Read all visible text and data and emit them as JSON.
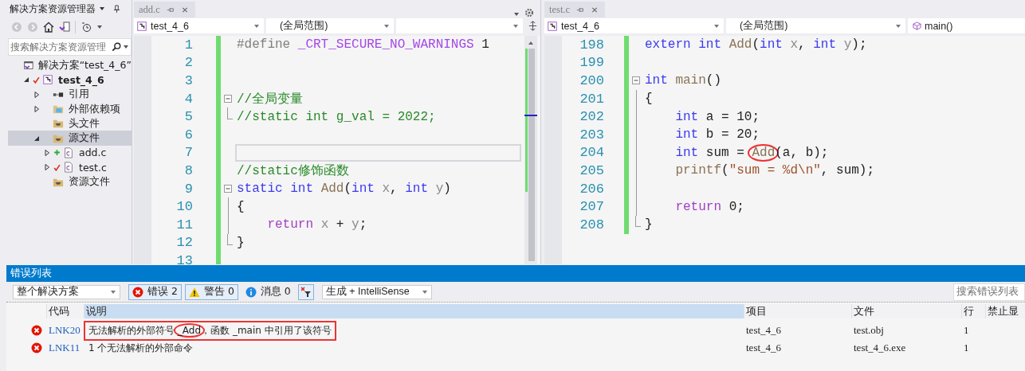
{
  "solution_explorer": {
    "title": "解决方案资源管理器",
    "search": {
      "placeholder": "搜索解决方案资源管理"
    },
    "tree": [
      {
        "label": "解决方案“test_4_6”",
        "kind": "solution",
        "selected": false,
        "modified": false,
        "added": false,
        "children": [
          {
            "label": "test_4_6",
            "kind": "project",
            "expanded": true,
            "selected": false,
            "modified": true,
            "added": false,
            "children": [
              {
                "label": "引用",
                "kind": "references",
                "expanded": false,
                "selected": false,
                "modified": false,
                "added": false
              },
              {
                "label": "外部依赖项",
                "kind": "external",
                "expanded": false,
                "selected": false,
                "modified": false,
                "added": false
              },
              {
                "label": "头文件",
                "kind": "folder",
                "selected": false,
                "modified": false,
                "added": false
              },
              {
                "label": "源文件",
                "kind": "folder",
                "expanded": true,
                "selected": true,
                "modified": false,
                "added": false,
                "children": [
                  {
                    "label": "add.c",
                    "kind": "file",
                    "expanded": false,
                    "selected": false,
                    "modified": false,
                    "added": true
                  },
                  {
                    "label": "test.c",
                    "kind": "file",
                    "expanded": false,
                    "selected": false,
                    "modified": true,
                    "added": false
                  }
                ]
              },
              {
                "label": "资源文件",
                "kind": "folder",
                "selected": false,
                "modified": false,
                "added": false
              }
            ]
          }
        ]
      }
    ]
  },
  "editors": [
    {
      "tab": "add.c",
      "overflow_tools": true,
      "nav": {
        "project": "test_4_6",
        "scope": "(全局范围)"
      },
      "lines": [
        {
          "n": "1",
          "kind": "plain",
          "current": false,
          "tokens": [
            {
              "kind": "pre",
              "text": "#define "
            },
            {
              "kind": "macro",
              "text": "_CRT_SECURE_NO_WARNINGS"
            },
            {
              "kind": "plain",
              "text": " 1"
            }
          ]
        },
        {
          "n": "2",
          "kind": "plain",
          "current": false
        },
        {
          "n": "3",
          "kind": "plain",
          "current": false
        },
        {
          "n": "4",
          "kind": "fold_start",
          "current": false,
          "tokens": [
            {
              "kind": "comment",
              "text": "//全局变量"
            }
          ]
        },
        {
          "n": "5",
          "kind": "fold_end",
          "current": false,
          "tokens": [
            {
              "kind": "comment",
              "text": "//static int g_val = 2022;"
            }
          ]
        },
        {
          "n": "6",
          "kind": "plain",
          "current": false
        },
        {
          "n": "7",
          "kind": "plain",
          "current": true
        },
        {
          "n": "8",
          "kind": "plain",
          "current": false,
          "tokens": [
            {
              "kind": "comment",
              "text": "//static修饰函数"
            }
          ]
        },
        {
          "n": "9",
          "kind": "fold_start",
          "current": false,
          "tokens": [
            {
              "kind": "kw",
              "text": "static int "
            },
            {
              "kind": "fn",
              "text": "Add"
            },
            {
              "kind": "plain",
              "text": "("
            },
            {
              "kind": "kw",
              "text": "int "
            },
            {
              "kind": "param",
              "text": "x"
            },
            {
              "kind": "plain",
              "text": ", "
            },
            {
              "kind": "kw",
              "text": "int "
            },
            {
              "kind": "param",
              "text": "y"
            },
            {
              "kind": "plain",
              "text": ")"
            }
          ]
        },
        {
          "n": "10",
          "kind": "fold_body",
          "current": false,
          "tokens": [
            {
              "kind": "plain",
              "text": "{"
            }
          ]
        },
        {
          "n": "11",
          "kind": "fold_body",
          "current": false,
          "tokens": [
            {
              "kind": "ctrl",
              "text": "    return "
            },
            {
              "kind": "param",
              "text": "x"
            },
            {
              "kind": "plain",
              "text": " + "
            },
            {
              "kind": "param",
              "text": "y"
            },
            {
              "kind": "plain",
              "text": ";"
            }
          ]
        },
        {
          "n": "12",
          "kind": "fold_end",
          "current": false,
          "tokens": [
            {
              "kind": "plain",
              "text": "}"
            }
          ]
        },
        {
          "n": "13",
          "kind": "plain",
          "current": false
        }
      ]
    },
    {
      "tab": "test.c",
      "overflow_tools": false,
      "nav": {
        "project": "test_4_6",
        "scope": "(全局范围)",
        "member": "main()"
      },
      "lines": [
        {
          "n": "198",
          "kind": "plain",
          "current": false,
          "tokens": [
            {
              "kind": "kw",
              "text": "extern int "
            },
            {
              "kind": "fn",
              "text": "Add"
            },
            {
              "kind": "plain",
              "text": "("
            },
            {
              "kind": "kw",
              "text": "int "
            },
            {
              "kind": "param",
              "text": "x"
            },
            {
              "kind": "plain",
              "text": ", "
            },
            {
              "kind": "kw",
              "text": "int "
            },
            {
              "kind": "param",
              "text": "y"
            },
            {
              "kind": "plain",
              "text": ");"
            }
          ]
        },
        {
          "n": "199",
          "kind": "plain",
          "current": false
        },
        {
          "n": "200",
          "kind": "fold_start",
          "current": false,
          "tokens": [
            {
              "kind": "kw",
              "text": "int "
            },
            {
              "kind": "fn",
              "text": "main"
            },
            {
              "kind": "plain",
              "text": "()"
            }
          ]
        },
        {
          "n": "201",
          "kind": "fold_body",
          "current": false,
          "tokens": [
            {
              "kind": "plain",
              "text": "{"
            }
          ]
        },
        {
          "n": "202",
          "kind": "fold_body",
          "current": false,
          "tokens": [
            {
              "kind": "kw",
              "text": "    int "
            },
            {
              "kind": "plain",
              "text": "a = 10;"
            }
          ]
        },
        {
          "n": "203",
          "kind": "fold_body",
          "current": false,
          "tokens": [
            {
              "kind": "kw",
              "text": "    int "
            },
            {
              "kind": "plain",
              "text": "b = 20;"
            }
          ]
        },
        {
          "n": "204",
          "kind": "fold_body",
          "current": false,
          "tokens": [
            {
              "kind": "kw",
              "text": "    int "
            },
            {
              "kind": "plain",
              "text": "sum = "
            },
            {
              "kind": "fn",
              "text": "Add",
              "circled": true
            },
            {
              "kind": "plain",
              "text": "(a, b);"
            }
          ]
        },
        {
          "n": "205",
          "kind": "fold_body",
          "current": false,
          "tokens": [
            {
              "kind": "fn",
              "text": "    printf"
            },
            {
              "kind": "plain",
              "text": "("
            },
            {
              "kind": "str",
              "text": "\"sum = %d\\n\""
            },
            {
              "kind": "plain",
              "text": ", sum);"
            }
          ]
        },
        {
          "n": "206",
          "kind": "fold_body",
          "current": false
        },
        {
          "n": "207",
          "kind": "fold_body",
          "current": false,
          "tokens": [
            {
              "kind": "ctrl",
              "text": "    return "
            },
            {
              "kind": "plain",
              "text": "0;"
            }
          ]
        },
        {
          "n": "208",
          "kind": "fold_end",
          "current": false,
          "tokens": [
            {
              "kind": "plain",
              "text": "}"
            }
          ]
        }
      ]
    }
  ],
  "error_list": {
    "title": "错误列表",
    "scope": "整个解决方案",
    "filters": [
      {
        "kind": "error",
        "label": "错误 2",
        "selected": true
      },
      {
        "kind": "warning",
        "label": "警告 0",
        "selected": true
      },
      {
        "kind": "message",
        "label": "消息 0",
        "selected": false
      }
    ],
    "source": "生成 + IntelliSense",
    "search": {
      "placeholder": "搜索错误列表"
    },
    "columns": [
      {
        "label": "代码",
        "selected": false
      },
      {
        "label": "说明",
        "selected": true
      },
      {
        "label": "项目",
        "selected": false
      },
      {
        "label": "文件",
        "selected": false
      },
      {
        "label": "行",
        "selected": false
      },
      {
        "label": "禁止显",
        "selected": false
      }
    ],
    "rows": [
      {
        "kind": "error",
        "code": "LNK20",
        "boxed": true,
        "description": [
          {
            "text": "无法解析的外部符号 "
          },
          {
            "text": "_Add",
            "circled": true
          },
          {
            "text": "，函数 _main 中引用了该符号"
          }
        ],
        "project": "test_4_6",
        "file": "test.obj",
        "line": "1"
      },
      {
        "kind": "error",
        "code": "LNK11",
        "boxed": false,
        "description": [
          {
            "text": "1 个无法解析的外部命令"
          }
        ],
        "project": "test_4_6",
        "file": "test_4_6.exe",
        "line": "1"
      }
    ]
  }
}
